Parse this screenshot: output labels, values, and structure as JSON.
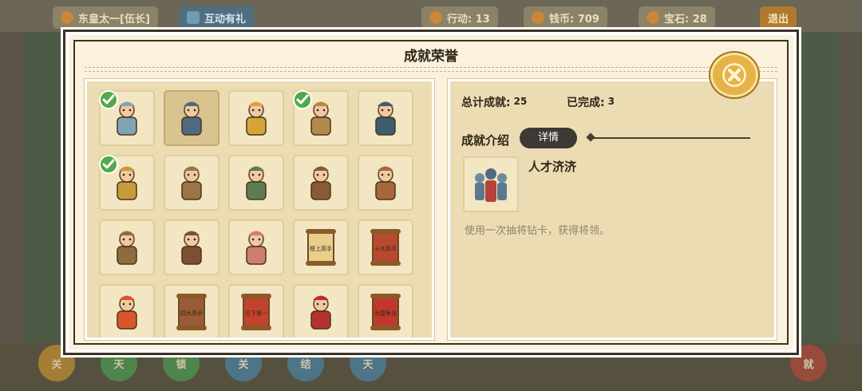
{
  "header": {
    "player": "东皇太一[伍长]",
    "gift": "互动有礼",
    "action": "行动: 13",
    "coins": "钱币: 709",
    "gems": "宝石: 28",
    "exit": "退出"
  },
  "bottom_nav": [
    "关",
    "天",
    "锁",
    "关",
    "结",
    "天",
    "就"
  ],
  "modal": {
    "title": "成就荣誉",
    "total_label": "总计成就:",
    "total_value": "25",
    "done_label": "已完成:",
    "done_value": "3",
    "intro_label": "成就介绍",
    "detail_button": "详情",
    "selected_name": "人才济济",
    "selected_desc": "使用一次抽将钻卡，获得将领。"
  },
  "achievements": [
    {
      "icon": "treasure-map-icon",
      "completed": true
    },
    {
      "icon": "generals-group-icon",
      "completed": false,
      "selected": true
    },
    {
      "icon": "rich-merchant-icon",
      "completed": false
    },
    {
      "icon": "scholar-reading-icon",
      "completed": true
    },
    {
      "icon": "emperor-icon",
      "completed": false
    },
    {
      "icon": "farmer-coins-icon",
      "completed": true
    },
    {
      "icon": "peasant-worker-icon",
      "completed": false
    },
    {
      "icon": "official-icon",
      "completed": false
    },
    {
      "icon": "horseman-icon",
      "completed": false
    },
    {
      "icon": "swordsman-icon",
      "completed": false
    },
    {
      "icon": "armored-general-icon",
      "completed": false
    },
    {
      "icon": "cavalry-charge-icon",
      "completed": false
    },
    {
      "icon": "couple-icon",
      "completed": false
    },
    {
      "icon": "scroll-top-icon",
      "completed": false,
      "text": "榜上高手"
    },
    {
      "icon": "scroll-ten-icon",
      "completed": false,
      "text": "十大高手"
    },
    {
      "icon": "dragon-icon",
      "completed": false
    },
    {
      "icon": "four-masters-banner-icon",
      "completed": false,
      "text": "四大高手"
    },
    {
      "icon": "world-first-scroll-icon",
      "completed": false,
      "text": "天下第一"
    },
    {
      "icon": "warlord-badge-icon",
      "completed": false
    },
    {
      "icon": "patriot-banner-icon",
      "completed": false,
      "text": "为国争光"
    }
  ],
  "colors": {
    "check": "#53a84a",
    "panel": "#ecdcb3",
    "close": "#e7b247"
  }
}
